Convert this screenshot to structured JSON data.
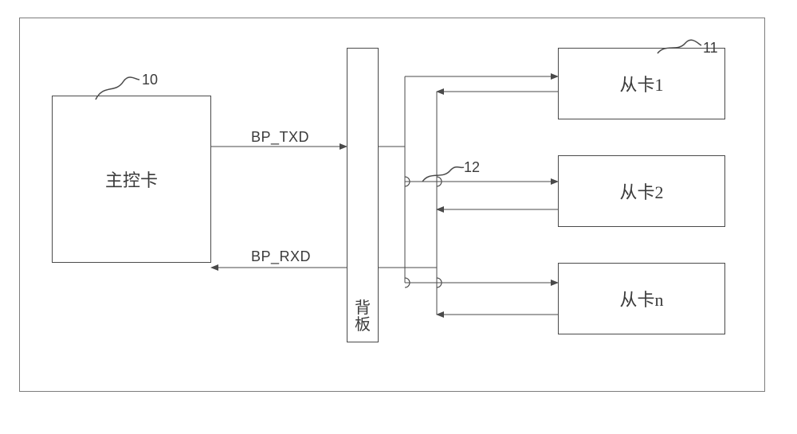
{
  "refs": {
    "master": "10",
    "slave1": "11",
    "backplane": "12"
  },
  "blocks": {
    "master": "主控卡",
    "backplane_line1": "背",
    "backplane_line2": "板",
    "slave1": "从卡1",
    "slave2": "从卡2",
    "slaven": "从卡n"
  },
  "signals": {
    "txd": "BP_TXD",
    "rxd": "BP_RXD"
  }
}
